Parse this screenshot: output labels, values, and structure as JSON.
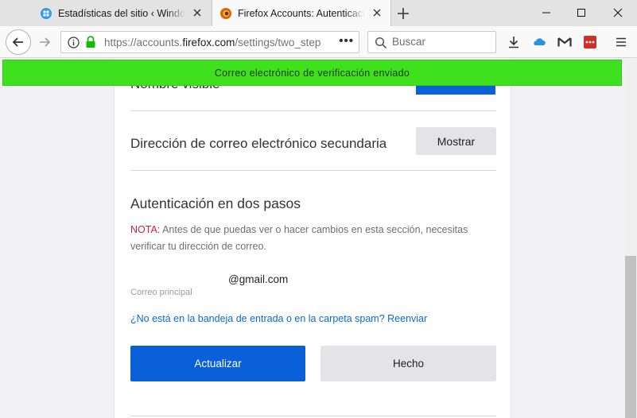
{
  "tabs": [
    {
      "title": "Estadísticas del sitio ‹ Windows",
      "favicon": "windows-logo-icon"
    },
    {
      "title": "Firefox Accounts: Autenticación",
      "favicon": "firefox-logo-icon"
    }
  ],
  "window_controls": {
    "minimize": "minimize-icon",
    "maximize": "maximize-icon",
    "close": "close-icon"
  },
  "navbar": {
    "url_prefix": "https://accounts.",
    "url_domain": "firefox.com",
    "url_suffix": "/settings/two_step",
    "url_more": "•••",
    "search_placeholder": "Buscar"
  },
  "notification": {
    "text": "Correo electrónico de verificación enviado",
    "color": "#3fe01e"
  },
  "settings": {
    "hidden_row_label": "Nombre visible",
    "secondary_email": {
      "label": "Dirección de correo electrónico secundaria",
      "button": "Mostrar"
    },
    "two_step": {
      "title": "Autenticación en dos pasos",
      "note_prefix": "NOTA:",
      "note_text": " Antes de que puedas ver o hacer cambios en esta sección, necesitas verificar tu dirección de correo.",
      "email": "@gmail.com",
      "email_label": "Correo principal",
      "resend_link": "¿No está en la bandeja de entrada o en la carpeta spam? Reenviar",
      "primary_button": "Actualizar",
      "secondary_button": "Hecho"
    }
  },
  "colors": {
    "accent": "#0a60d8",
    "note_red": "#d31f3e",
    "link": "#0a6ad1"
  }
}
